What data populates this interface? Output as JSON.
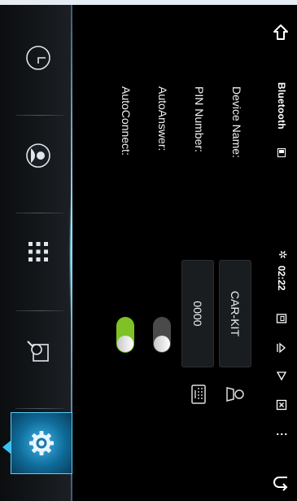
{
  "statusbar": {
    "title": "Bluetooth",
    "bt_symbol": "✲",
    "time": "02:22",
    "more": "⋮",
    "icons": [
      "back-icon",
      "bluetooth-small-icon",
      "sd-card-icon",
      "eject-icon",
      "play-icon",
      "close-box-icon",
      "more-icon",
      "return-icon"
    ]
  },
  "settings": {
    "device_name_label": "Device Name:",
    "device_name_value": "CAR-KIT",
    "pin_label": "PIN Number:",
    "pin_value": "0000",
    "auto_answer_label": "AutoAnswer:",
    "auto_answer_on": false,
    "auto_connect_label": "AutoConnect:",
    "auto_connect_on": true
  },
  "dock": {
    "items": [
      "clock-icon",
      "contacts-icon",
      "apps-grid-icon",
      "search-icon",
      "settings-icon"
    ],
    "active": "settings-icon"
  },
  "colors": {
    "accent": "#37c1f4",
    "toggle_on": "#7ec224",
    "background": "#000000"
  }
}
